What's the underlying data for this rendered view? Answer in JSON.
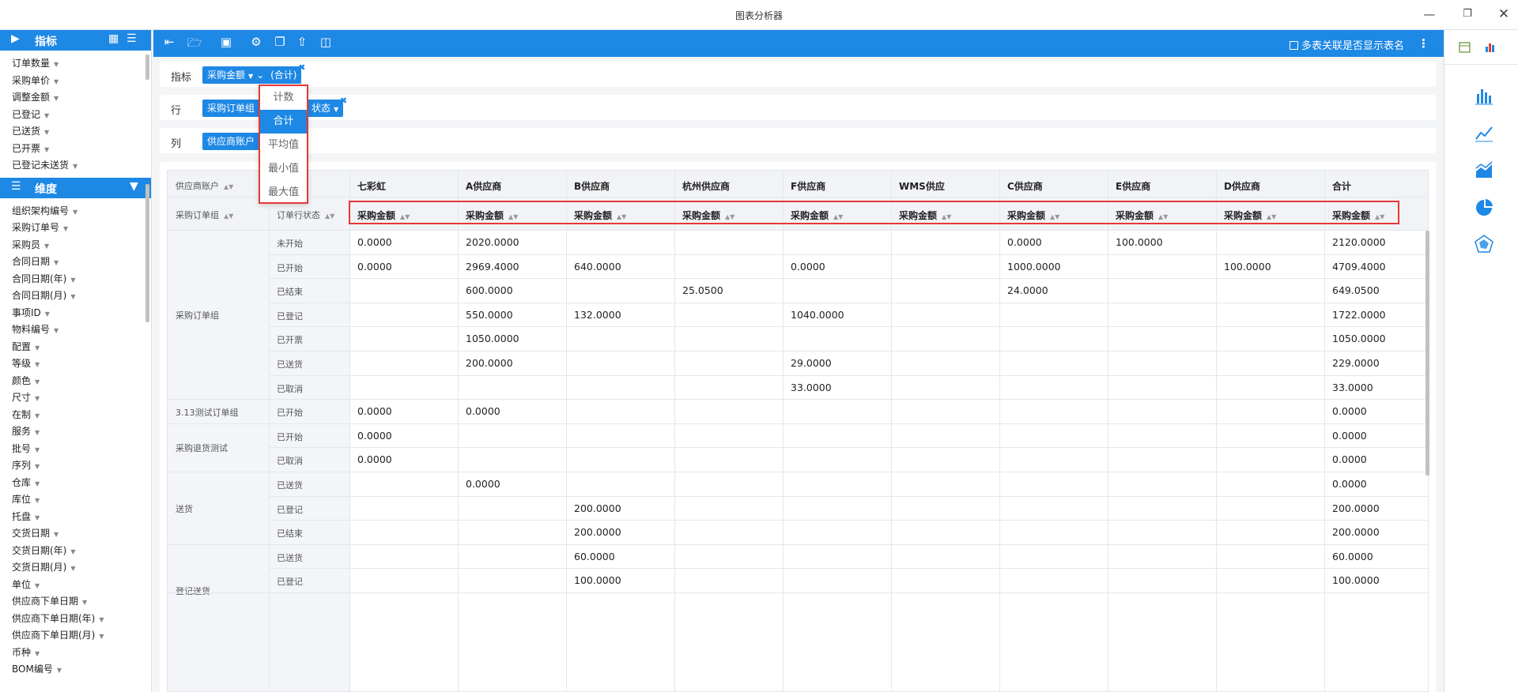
{
  "window": {
    "title": "图表分析器",
    "controls": [
      "minimize-icon",
      "restore-icon",
      "close-icon"
    ]
  },
  "sidebar": {
    "metrics_title": "指标",
    "metrics": [
      "订单数量",
      "采购单价",
      "调整金额",
      "已登记",
      "已送货",
      "已开票",
      "已登记未送货"
    ],
    "dimensions_title": "维度",
    "dimensions": [
      "组织架构编号",
      "采购订单号",
      "采购员",
      "合同日期",
      "合同日期(年)",
      "合同日期(月)",
      "事项ID",
      "物料编号",
      "配置",
      "等级",
      "颜色",
      "尺寸",
      "在制",
      "服务",
      "批号",
      "序列",
      "仓库",
      "库位",
      "托盘",
      "交货日期",
      "交货日期(年)",
      "交货日期(月)",
      "单位",
      "供应商下单日期",
      "供应商下单日期(年)",
      "供应商下单日期(月)",
      "币种",
      "BOM编号"
    ]
  },
  "toolbar": {
    "icons": [
      "indent-icon",
      "folder-open-icon",
      "save-icon",
      "gear-icon",
      "copy-icon",
      "export-icon",
      "layers-icon"
    ],
    "checkbox_label": "多表关联是否显示表名",
    "accent": "#1e88e5"
  },
  "fields": {
    "metrics_label": "指标",
    "metric_pill": "采购金额",
    "metric_agg": "(合计)",
    "rows_label": "行",
    "row_pill_1": "采购订单组",
    "row_pill_2": "状态",
    "cols_label": "列",
    "col_pill": "供应商账户"
  },
  "agg_menu": {
    "options": [
      "计数",
      "合计",
      "平均值",
      "最小值",
      "最大值"
    ],
    "selected": "合计"
  },
  "table": {
    "corner_col": "供应商账户",
    "corner_row1": "采购订单组",
    "corner_row2": "订单行状态",
    "suppliers": [
      "七彩虹",
      "A供应商",
      "B供应商",
      "杭州供应商",
      "F供应商",
      "WMS供应",
      "C供应商",
      "E供应商",
      "D供应商",
      "合计"
    ],
    "measure": "采购金额",
    "groups": [
      {
        "name": "采购订单组",
        "span": 7
      },
      {
        "name": "3.13测试订单组",
        "span": 1
      },
      {
        "name": "采购退货测试",
        "span": 2
      },
      {
        "name": "送货",
        "span": 3
      },
      {
        "name": "登记送货",
        "span": 2
      }
    ],
    "rows": [
      {
        "status": "未开始",
        "values": [
          "0.0000",
          "2020.0000",
          "",
          "",
          "",
          "",
          "0.0000",
          "100.0000",
          "",
          "2120.0000"
        ]
      },
      {
        "status": "已开始",
        "values": [
          "0.0000",
          "2969.4000",
          "640.0000",
          "",
          "0.0000",
          "",
          "1000.0000",
          "",
          "100.0000",
          "4709.4000"
        ]
      },
      {
        "status": "已结束",
        "values": [
          "",
          "600.0000",
          "",
          "25.0500",
          "",
          "",
          "24.0000",
          "",
          "",
          "649.0500"
        ]
      },
      {
        "status": "已登记",
        "values": [
          "",
          "550.0000",
          "132.0000",
          "",
          "1040.0000",
          "",
          "",
          "",
          "",
          "1722.0000"
        ]
      },
      {
        "status": "已开票",
        "values": [
          "",
          "1050.0000",
          "",
          "",
          "",
          "",
          "",
          "",
          "",
          "1050.0000"
        ]
      },
      {
        "status": "已送货",
        "values": [
          "",
          "200.0000",
          "",
          "",
          "29.0000",
          "",
          "",
          "",
          "",
          "229.0000"
        ]
      },
      {
        "status": "已取消",
        "values": [
          "",
          "",
          "",
          "",
          "33.0000",
          "",
          "",
          "",
          "",
          "33.0000"
        ]
      },
      {
        "status": "已开始",
        "values": [
          "0.0000",
          "0.0000",
          "",
          "",
          "",
          "",
          "",
          "",
          "",
          "0.0000"
        ]
      },
      {
        "status": "已开始",
        "values": [
          "0.0000",
          "",
          "",
          "",
          "",
          "",
          "",
          "",
          "",
          "0.0000"
        ]
      },
      {
        "status": "已取消",
        "values": [
          "0.0000",
          "",
          "",
          "",
          "",
          "",
          "",
          "",
          "",
          "0.0000"
        ]
      },
      {
        "status": "已送货",
        "values": [
          "",
          "0.0000",
          "",
          "",
          "",
          "",
          "",
          "",
          "",
          "0.0000"
        ]
      },
      {
        "status": "已登记",
        "values": [
          "",
          "",
          "200.0000",
          "",
          "",
          "",
          "",
          "",
          "",
          "200.0000"
        ]
      },
      {
        "status": "已结束",
        "values": [
          "",
          "",
          "200.0000",
          "",
          "",
          "",
          "",
          "",
          "",
          "200.0000"
        ]
      },
      {
        "status": "已送货",
        "values": [
          "",
          "",
          "60.0000",
          "",
          "",
          "",
          "",
          "",
          "",
          "60.0000"
        ]
      },
      {
        "status": "已登记",
        "values": [
          "",
          "",
          "100.0000",
          "",
          "",
          "",
          "",
          "",
          "",
          "100.0000"
        ]
      }
    ]
  },
  "right_panel": {
    "tabs": [
      "table-icon",
      "chart-tab-icon"
    ],
    "chart_types": [
      "bar-chart-icon",
      "line-chart-icon",
      "area-chart-icon",
      "pie-chart-icon",
      "radar-chart-icon"
    ]
  }
}
